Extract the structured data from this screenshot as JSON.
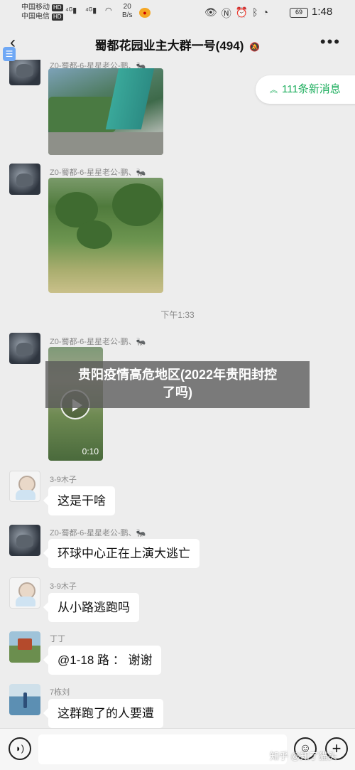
{
  "status_bar": {
    "carrier1": "中国移动",
    "carrier2": "中国电信",
    "hd": "HD",
    "signal1": "⁴⁶",
    "signal2": "⁴⁶",
    "net_speed_value": "20",
    "net_speed_unit": "B/s",
    "battery": "69",
    "time": "1:48"
  },
  "header": {
    "back_icon": "‹",
    "title": "蜀都花园业主大群一号(494)",
    "more_icon": "•••"
  },
  "new_messages_banner": "111条新消息",
  "messages": [
    {
      "sender": "Z0-蜀都-6-星星老公-鹏、🐜",
      "type": "image"
    },
    {
      "sender": "Z0-蜀都-6-星星老公-鹏、🐜",
      "type": "image"
    },
    {
      "sender": "Z0-蜀都-6-星星老公-鹏、🐜",
      "type": "video",
      "duration": "0:10"
    },
    {
      "sender": "3-9木子",
      "text": "这是干啥"
    },
    {
      "sender": "Z0-蜀都-6-星星老公-鹏、🐜",
      "text": "环球中心正在上演大逃亡"
    },
    {
      "sender": "3-9木子",
      "text": "从小路逃跑吗"
    },
    {
      "sender": "丁丁",
      "text": "@1-18  路 ： 谢谢"
    },
    {
      "sender": "7栋刘",
      "text": "这群跑了的人要遭"
    }
  ],
  "timestamp": "下午1:33",
  "headline": {
    "line1": "贵阳疫情高危地区(2022年贵阳封控",
    "line2": "了吗)"
  },
  "input_bar": {
    "voice_icon": "voice-icon",
    "emoji_icon": "emoji-icon",
    "plus_icon": "plus-icon"
  },
  "watermark": "知乎 @知了猫头"
}
